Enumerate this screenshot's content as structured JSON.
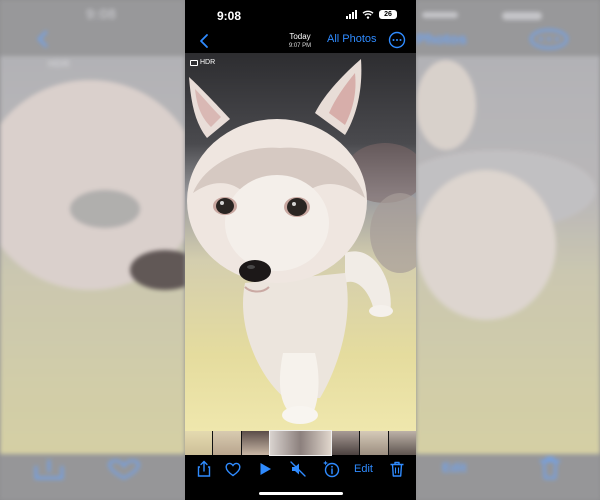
{
  "status_bar": {
    "time": "9:08",
    "battery": "26"
  },
  "nav": {
    "title": "Today",
    "subtitle": "9:07 PM",
    "all_photos": "All Photos"
  },
  "photo": {
    "badge": "HDR"
  },
  "toolbar": {
    "edit_label": "Edit"
  },
  "background_ghost": {
    "left": {
      "time": "9:08",
      "badge": "HDR"
    },
    "right": {
      "all_photos": "Photos",
      "edit_label": "Edit"
    }
  },
  "colors": {
    "accent": "#2f8bff",
    "bar_background": "#000000"
  },
  "icons": {
    "back": "chevron-left-icon",
    "more": "ellipsis-circle-icon",
    "share": "share-icon",
    "favorite": "heart-icon",
    "play": "play-icon",
    "mute": "speaker-muted-icon",
    "info": "info-sparkle-icon",
    "delete": "trash-icon"
  }
}
